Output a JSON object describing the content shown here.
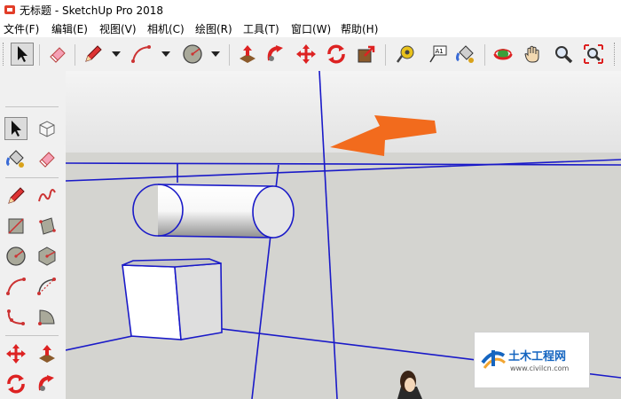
{
  "window": {
    "title": "无标题 - SketchUp Pro 2018"
  },
  "menu": [
    {
      "label": "文件(F)"
    },
    {
      "label": "编辑(E)"
    },
    {
      "label": "视图(V)"
    },
    {
      "label": "相机(C)"
    },
    {
      "label": "绘图(R)"
    },
    {
      "label": "工具(T)"
    },
    {
      "label": "窗口(W)"
    },
    {
      "label": "帮助(H)"
    }
  ],
  "toolbar": {
    "text_tool_glyph": "A1",
    "tools": [
      "select-icon",
      "eraser-icon",
      "pencil-icon",
      "arc-icon",
      "circle-icon",
      "push-pull-icon",
      "follow-me-icon",
      "move-icon",
      "rotate-icon",
      "scale-icon",
      "tape-measure-icon",
      "text-icon",
      "paint-bucket-icon",
      "orbit-icon",
      "pan-icon",
      "zoom-icon",
      "zoom-extents-icon"
    ]
  },
  "left_toolbar": {
    "tools": [
      "select-icon",
      "make-component-icon",
      "paint-bucket-icon",
      "eraser-icon",
      "line-icon",
      "freehand-icon",
      "rectangle-icon",
      "rotated-rectangle-icon",
      "circle-icon",
      "polygon-icon",
      "arc-icon",
      "two-point-arc-icon",
      "three-point-arc-icon",
      "pie-icon",
      "move-icon",
      "push-pull-icon",
      "rotate-icon",
      "follow-me-icon"
    ]
  },
  "watermark": {
    "brand": "土木工程网",
    "url": "www.civilcn.com"
  },
  "colors": {
    "sky": "#e3e3e3",
    "ground": "#d4d4d0",
    "edge_blue": "#1a1ac8",
    "arrow_orange": "#f26b1d",
    "selected_bg": "#dcdcdc",
    "watermark_blue": "#1565c0"
  }
}
